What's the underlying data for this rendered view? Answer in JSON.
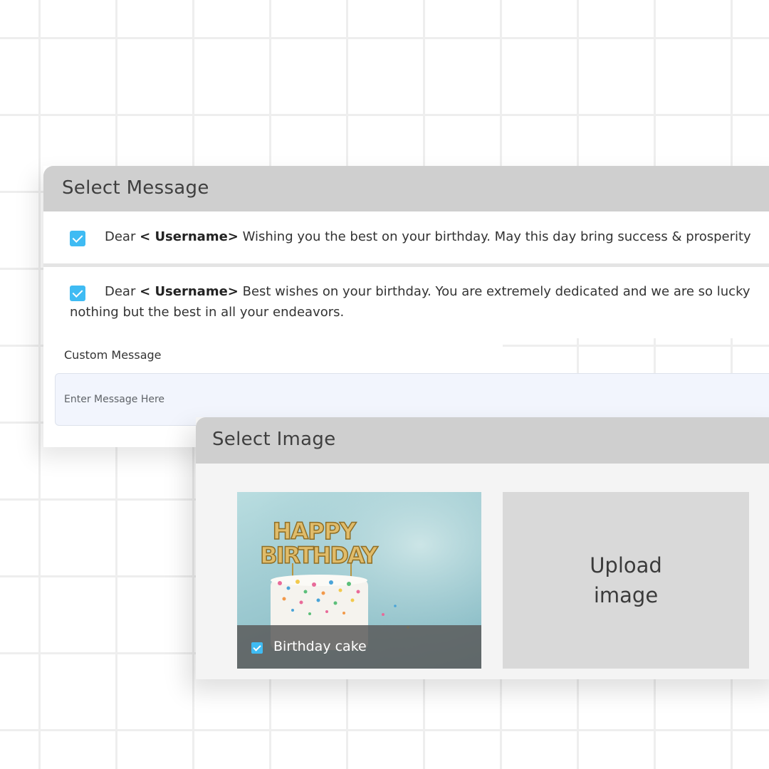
{
  "select_message": {
    "title": "Select Message",
    "messages": [
      {
        "checked": true,
        "prefix": "Dear ",
        "placeholder_token": "< Username>",
        "text": " Wishing you the best on your birthday. May this day bring success & prosperity"
      },
      {
        "checked": true,
        "prefix": "Dear ",
        "placeholder_token": "< Username>",
        "text": " Best wishes on your birthday. You are extremely dedicated and we are so lucky",
        "text_line2": "nothing but the best in all your endeavors."
      }
    ],
    "custom_message": {
      "label": "Custom Message",
      "placeholder": "Enter Message Here",
      "value": ""
    }
  },
  "select_image": {
    "title": "Select Image",
    "images": [
      {
        "caption": "Birthday cake",
        "checked": true,
        "topper_line1": "HAPPY",
        "topper_line2": "BIRTHDAY"
      }
    ],
    "upload_label": "Upload\nimage"
  },
  "colors": {
    "checkbox": "#3fbbf3",
    "header_bg": "#cfcfcf",
    "input_bg": "#f2f5fd",
    "upload_bg": "#d9d9d9"
  }
}
